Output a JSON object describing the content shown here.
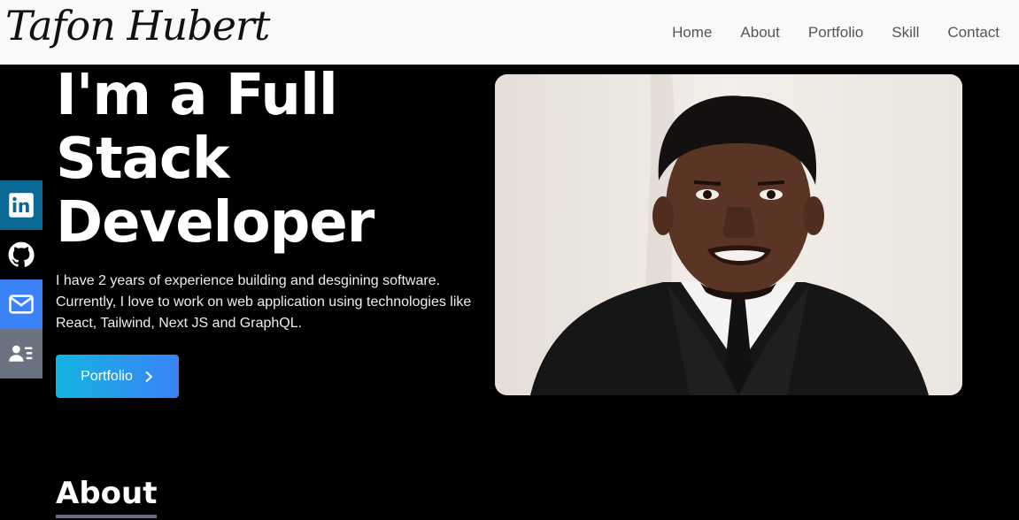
{
  "header": {
    "logo_text": "Tafon Hubert",
    "nav": [
      "Home",
      "About",
      "Portfolio",
      "Skill",
      "Contact"
    ]
  },
  "social": [
    {
      "icon": "linkedin-icon",
      "color": "#0a6a95"
    },
    {
      "icon": "github-icon",
      "color": "#000000"
    },
    {
      "icon": "mail-icon",
      "color": "#3b82f6"
    },
    {
      "icon": "contact-card-icon",
      "color": "#6b7280"
    }
  ],
  "hero": {
    "title": "I'm a Full Stack Developer",
    "description": "I have 2 years of experience building and desgining software. Currently, I love to work on web application using technologies like React, Tailwind, Next JS and GraphQL.",
    "button_label": "Portfolio"
  },
  "about": {
    "heading": "About"
  },
  "colors": {
    "background": "#000000",
    "header_bg": "#f8f9fb",
    "button_gradient_start": "#13b4e2",
    "button_gradient_end": "#3b82f6"
  }
}
